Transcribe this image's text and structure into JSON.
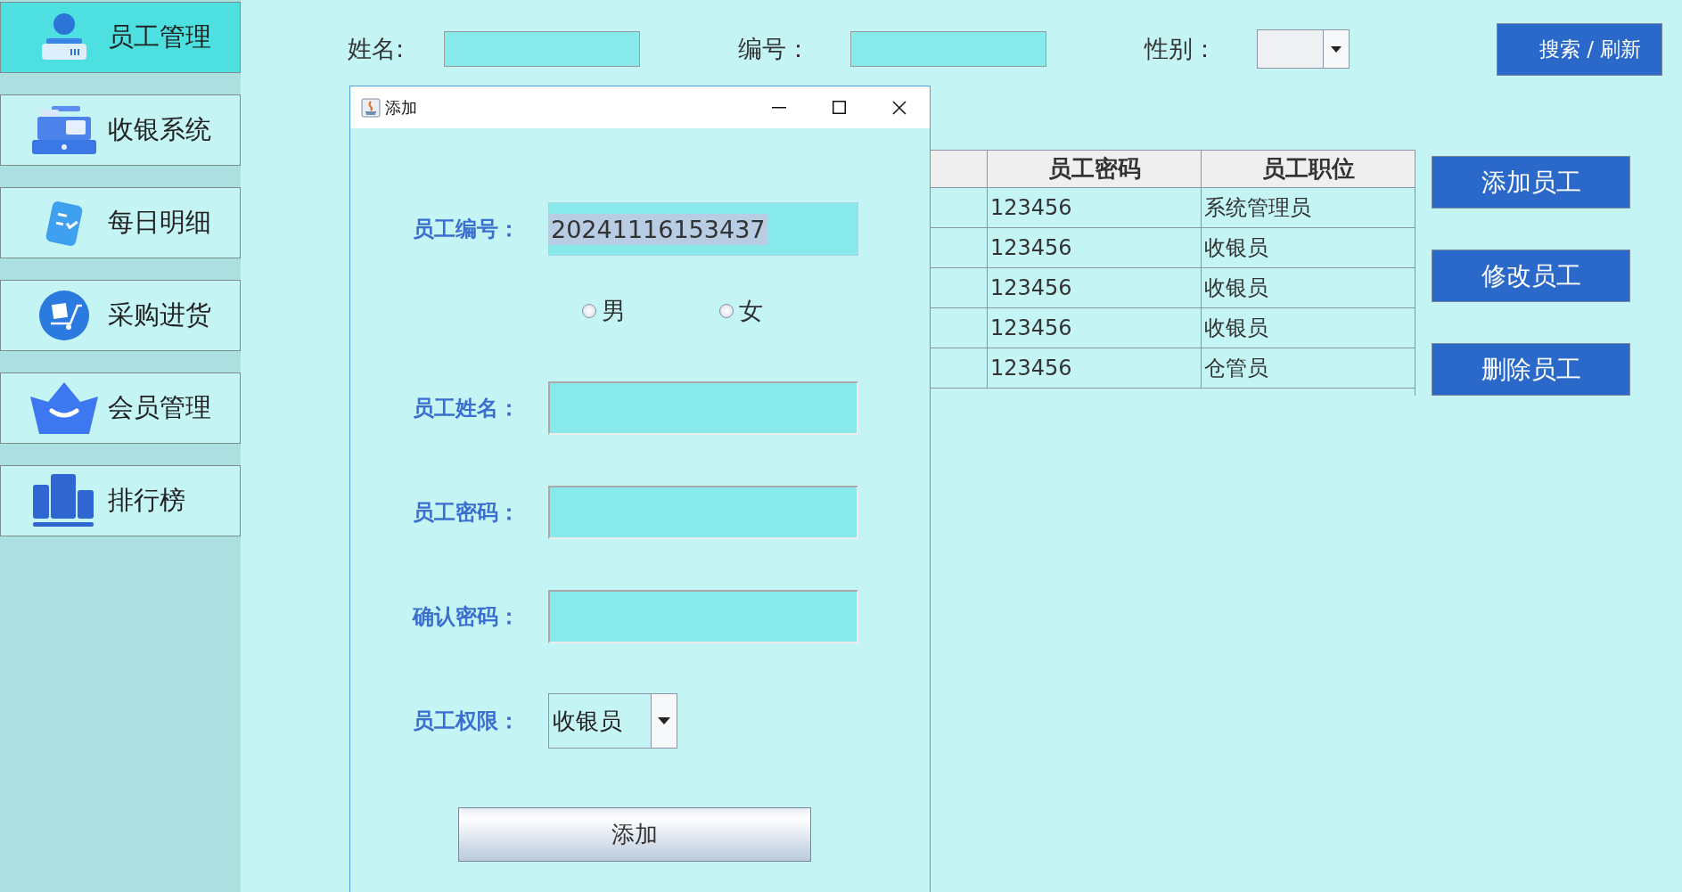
{
  "sidebar": {
    "items": [
      {
        "label": "员工管理",
        "selected": true,
        "kind": "staff"
      },
      {
        "label": "收银系统",
        "selected": false,
        "kind": "register"
      },
      {
        "label": "每日明细",
        "selected": false,
        "kind": "clipboard"
      },
      {
        "label": "采购进货",
        "selected": false,
        "kind": "cart"
      },
      {
        "label": "会员管理",
        "selected": false,
        "kind": "crown"
      },
      {
        "label": "排行榜",
        "selected": false,
        "kind": "podium"
      }
    ]
  },
  "search": {
    "fields": [
      {
        "label": "姓名:",
        "kind": "text"
      },
      {
        "label": "编号：",
        "kind": "text"
      },
      {
        "label": "性别：",
        "kind": "combo"
      }
    ],
    "button": "搜索 / 刷新"
  },
  "table": {
    "columns": [
      "员工密码",
      "员工职位"
    ],
    "rows": [
      [
        "123456",
        "系统管理员"
      ],
      [
        "123456",
        "收银员"
      ],
      [
        "123456",
        "收银员"
      ],
      [
        "123456",
        "收银员"
      ],
      [
        "123456",
        "仓管员"
      ]
    ]
  },
  "actions": [
    "添加员工",
    "修改员工",
    "删除员工"
  ],
  "dialog": {
    "title": "添加",
    "rows": [
      {
        "kind": "text",
        "label": "员工编号：",
        "value": "20241116153437",
        "value_selected": true
      },
      {
        "kind": "radio",
        "options": [
          {
            "label": "男",
            "selected": false
          },
          {
            "label": "女",
            "selected": false
          }
        ]
      },
      {
        "kind": "text",
        "label": "员工姓名："
      },
      {
        "kind": "text",
        "label": "员工密码："
      },
      {
        "kind": "text",
        "label": "确认密码："
      },
      {
        "kind": "combo",
        "label": "员工权限：",
        "value": "收银员"
      }
    ],
    "button": "添加"
  }
}
